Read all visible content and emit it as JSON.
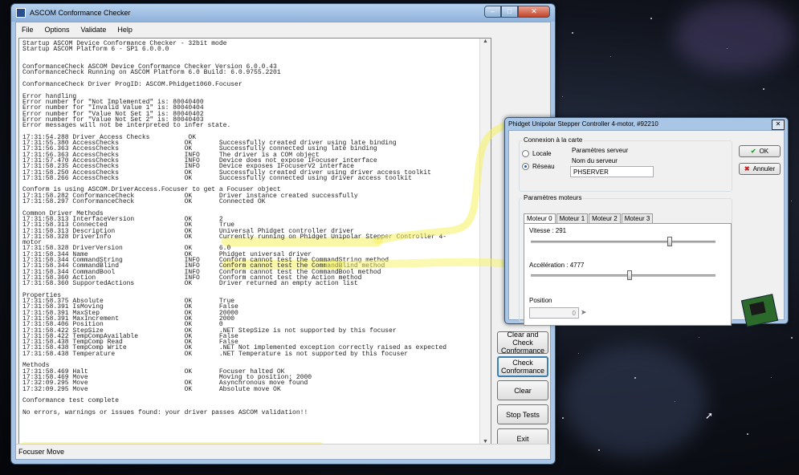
{
  "main_window": {
    "title": "ASCOM Conformance Checker",
    "menu": [
      "File",
      "Options",
      "Validate",
      "Help"
    ],
    "status": "Focuser Move",
    "buttons": {
      "clear_and_check": "Clear and Check Conformance",
      "check": "Check Conformance",
      "clear": "Clear",
      "stop_tests": "Stop Tests",
      "exit": "Exit"
    },
    "log": [
      "Startup ASCOM Device Conformance Checker - 32bit mode",
      "Startup ASCOM Platform 6 - SP1 6.0.0.0",
      "",
      "",
      "ConformanceCheck ASCOM Device Conformance Checker Version 6.0.0.43",
      "ConformanceCheck Running on ASCOM Platform 6.0 Build: 6.0.9755.2201",
      "",
      "ConformanceCheck Driver ProgID: ASCOM.Phidget1060.Focuser",
      "",
      "Error handling",
      "Error number for \"Not Implemented\" is: 80040400",
      "Error number for \"Invalid Value 1\" is: 80040404",
      "Error number for \"Value Not Set 1\" is: 80040402",
      "Error number for \"Value Not Set 2\" is: 80040403",
      "Error messages will not be interpreted to infer state.",
      "",
      "17:31:54.288 Driver Access Checks          OK",
      "17:31:55.380 AccessChecks                 OK       Successfully created driver using late binding",
      "17:31:56.363 AccessChecks                 OK       Successfully connected using late binding",
      "17:31:56.363 AccessChecks                 INFO     The driver is a COM object",
      "17:31:57.470 AccessChecks                 INFO     Device does not expose IFocuser interface",
      "17:31:58.235 AccessChecks                 INFO     Device exposes IFocuserV2 interface",
      "17:31:58.250 AccessChecks                 OK       Successfully created driver using driver access toolkit",
      "17:31:58.266 AccessChecks                 OK       Successfully connected using driver access toolkit",
      "",
      "Conform is using ASCOM.DriverAccess.Focuser to get a Focuser object",
      "17:31:58.282 ConformanceCheck             OK       Driver instance created successfully",
      "17:31:58.297 ConformanceCheck             OK       Connected OK",
      "",
      "Common Driver Methods",
      "17:31:58.313 InterfaceVersion             OK       2",
      "17:31:58.313 Connected                    OK       True",
      "17:31:58.313 Description                  OK       Universal Phidget controller driver",
      "17:31:58.328 DriverInfo                   OK       Currently running on Phidget Unipolar Stepper Controller 4-",
      "motor",
      "17:31:58.328 DriverVersion                OK       6.0",
      "17:31:58.344 Name                         OK       Phidget universal driver",
      "17:31:58.344 CommandString                INFO     Conform cannot test the CommandString method",
      "17:31:58.344 CommandBlind                 INFO     Conform cannot test the CommandBlind method",
      "17:31:58.344 CommandBool                  INFO     Conform cannot test the CommandBool method",
      "17:31:58.360 Action                       INFO     Conform cannot test the Action method",
      "17:31:58.360 SupportedActions             OK       Driver returned an empty action list",
      "",
      "Properties",
      "17:31:58.375 Absolute                     OK       True",
      "17:31:58.391 IsMoving                     OK       False",
      "17:31:58.391 MaxStep                      OK       20000",
      "17:31:58.391 MaxIncrement                 OK       2000",
      "17:31:58.406 Position                     OK       0",
      "17:31:58.422 StepSize                     OK       .NET StepSize is not supported by this focuser",
      "17:31:58.422 TempCompAvailable            OK       False",
      "17:31:58.438 TempComp Read                OK       False",
      "17:31:58.438 TempComp Write               OK       .NET Not implemented exception correctly raised as expected",
      "17:31:58.438 Temperature                  OK       .NET Temperature is not supported by this focuser",
      "",
      "Methods",
      "17:31:58.469 Halt                         OK       Focuser halted OK",
      "17:31:58.469 Move                                  Moving to position: 2000",
      "17:32:09.295 Move                         OK       Asynchronous move found",
      "17:32:09.295 Move                         OK       Absolute move OK",
      "",
      "Conformance test complete",
      "",
      "No errors, warnings or issues found: your driver passes ASCOM validation!!"
    ]
  },
  "phidget_window": {
    "title": "Phidget Unipolar Stepper Controller 4-motor, #92210",
    "connection_group": "Connexion à la carte",
    "radio_local": "Locale",
    "radio_network": "Réseau",
    "server_params": "Paramètres serveur",
    "server_name_label": "Nom du serveur",
    "server_name_value": "PHSERVER",
    "ok_button": "OK",
    "cancel_button": "Annuler",
    "motor_group": "Paramètres moteurs",
    "tabs": [
      "Moteur 0",
      "Moteur 1",
      "Moteur 2",
      "Moteur 3"
    ],
    "speed_label": "Vitesse : 291",
    "accel_label": "Accélération : 4777",
    "position_label": "Position",
    "position_value": "0"
  },
  "colors": {
    "highlight": "#f6f35f",
    "window_frame": "#a9c6e6"
  }
}
